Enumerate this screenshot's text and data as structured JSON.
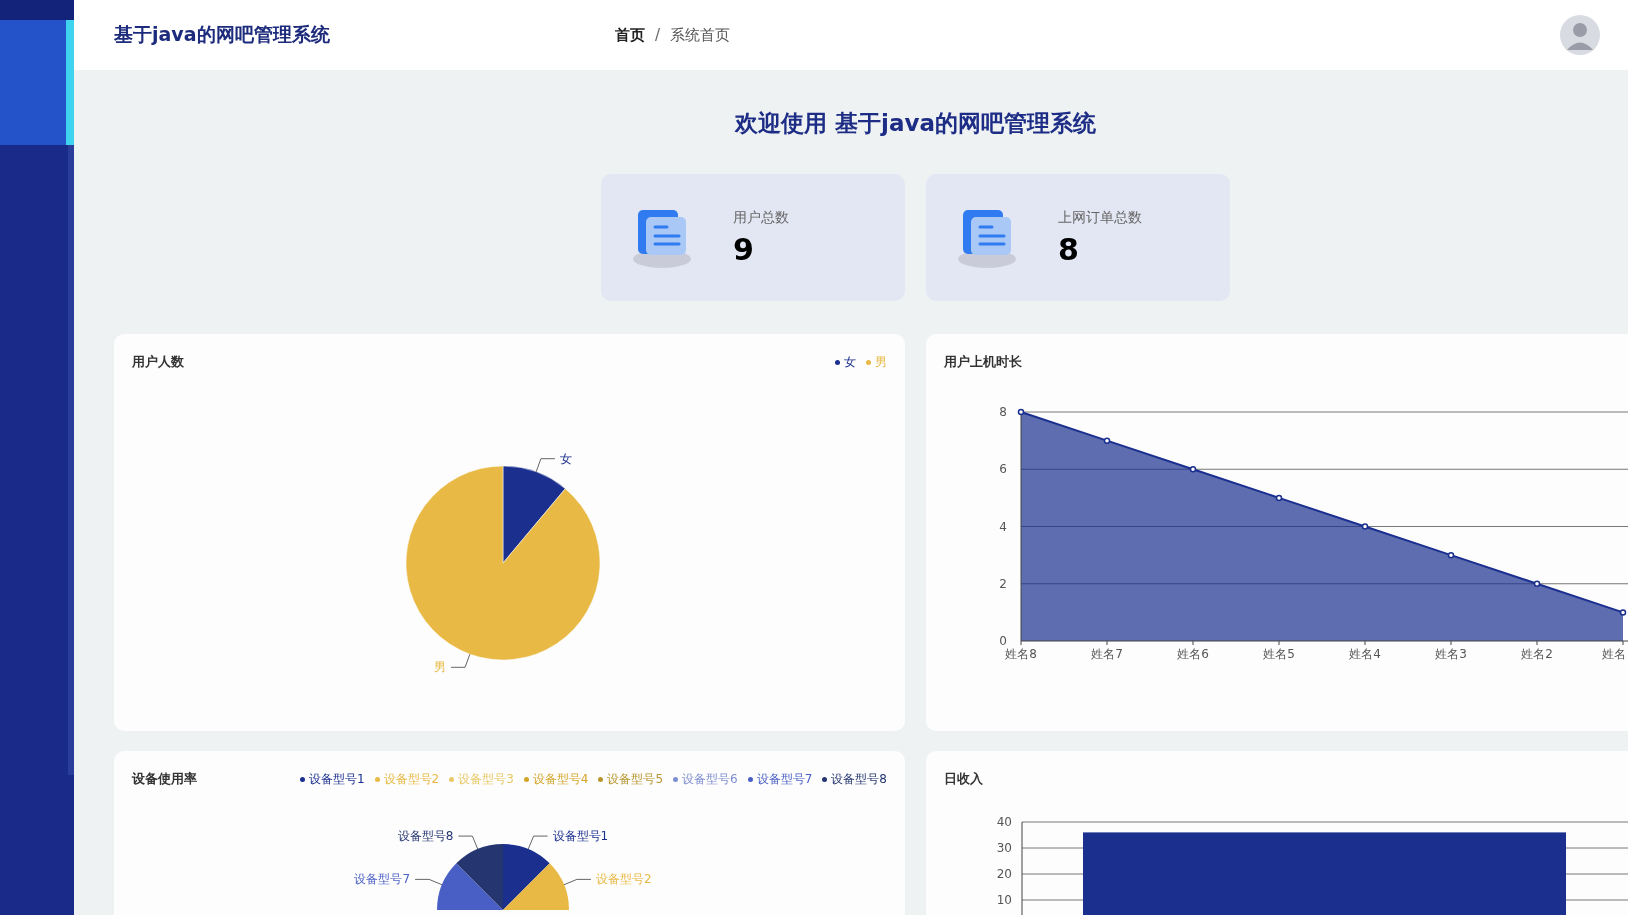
{
  "header": {
    "title": "基于java的网吧管理系统",
    "separator": "/",
    "breadcrumb": [
      {
        "label": "首页",
        "current": false
      },
      {
        "label": "系统首页",
        "current": true
      }
    ]
  },
  "welcome_title": "欢迎使用 基于java的网吧管理系统",
  "stats": [
    {
      "label": "用户总数",
      "value": "9"
    },
    {
      "label": "上网订单总数",
      "value": "8"
    }
  ],
  "panels": [
    {
      "title": "用户人数",
      "legend": [
        {
          "label": "女",
          "color": "#1a2f8e"
        },
        {
          "label": "男",
          "color": "#e8b944"
        }
      ],
      "chart_data": {
        "type": "pie",
        "categories": [
          "女",
          "男"
        ],
        "values": [
          11.1,
          88.9
        ]
      }
    },
    {
      "title": "用户上机时长",
      "chart_data": {
        "type": "area",
        "categories": [
          "姓名8",
          "姓名7",
          "姓名6",
          "姓名5",
          "姓名4",
          "姓名3",
          "姓名2",
          "姓名"
        ],
        "series": [
          {
            "color": "#1a2f8e",
            "values": [
              8,
              7,
              6,
              5,
              4,
              3,
              2,
              1
            ]
          }
        ],
        "ylim": [
          0,
          8
        ],
        "yticks": [
          0,
          2,
          4,
          6,
          8
        ],
        "grid": true
      }
    },
    {
      "title": "设备使用率",
      "kind": "drawing",
      "legend": [
        {
          "label": "设备型号1",
          "color": "#1a2f8e"
        },
        {
          "label": "设备型号2",
          "color": "#e8b944"
        },
        {
          "label": "设备型号3",
          "color": "#e9c866"
        },
        {
          "label": "设备型号4",
          "color": "#d4a529"
        },
        {
          "label": "设备型号5",
          "color": "#b8952c"
        },
        {
          "label": "设备型号6",
          "color": "#7d8ed0"
        },
        {
          "label": "设备型号7",
          "color": "#4a5fc5"
        },
        {
          "label": "设备型号8",
          "color": "#253570"
        }
      ],
      "slice_labels": [
        {
          "text": "设备型号8",
          "color": "#253570"
        },
        {
          "text": "设备型号1",
          "color": "#1a2f8e"
        },
        {
          "text": "设备型号7",
          "color": "#4a5fc5"
        },
        {
          "text": "设备型号2",
          "color": "#e8b944"
        }
      ]
    },
    {
      "title": "日收入",
      "chart_data": {
        "type": "bar",
        "series": [
          {
            "color": "#1a2f8e",
            "values": [
              36
            ]
          }
        ],
        "ylim": [
          0,
          40
        ],
        "yticks": [
          10,
          20,
          30,
          40
        ],
        "grid": true
      }
    }
  ]
}
